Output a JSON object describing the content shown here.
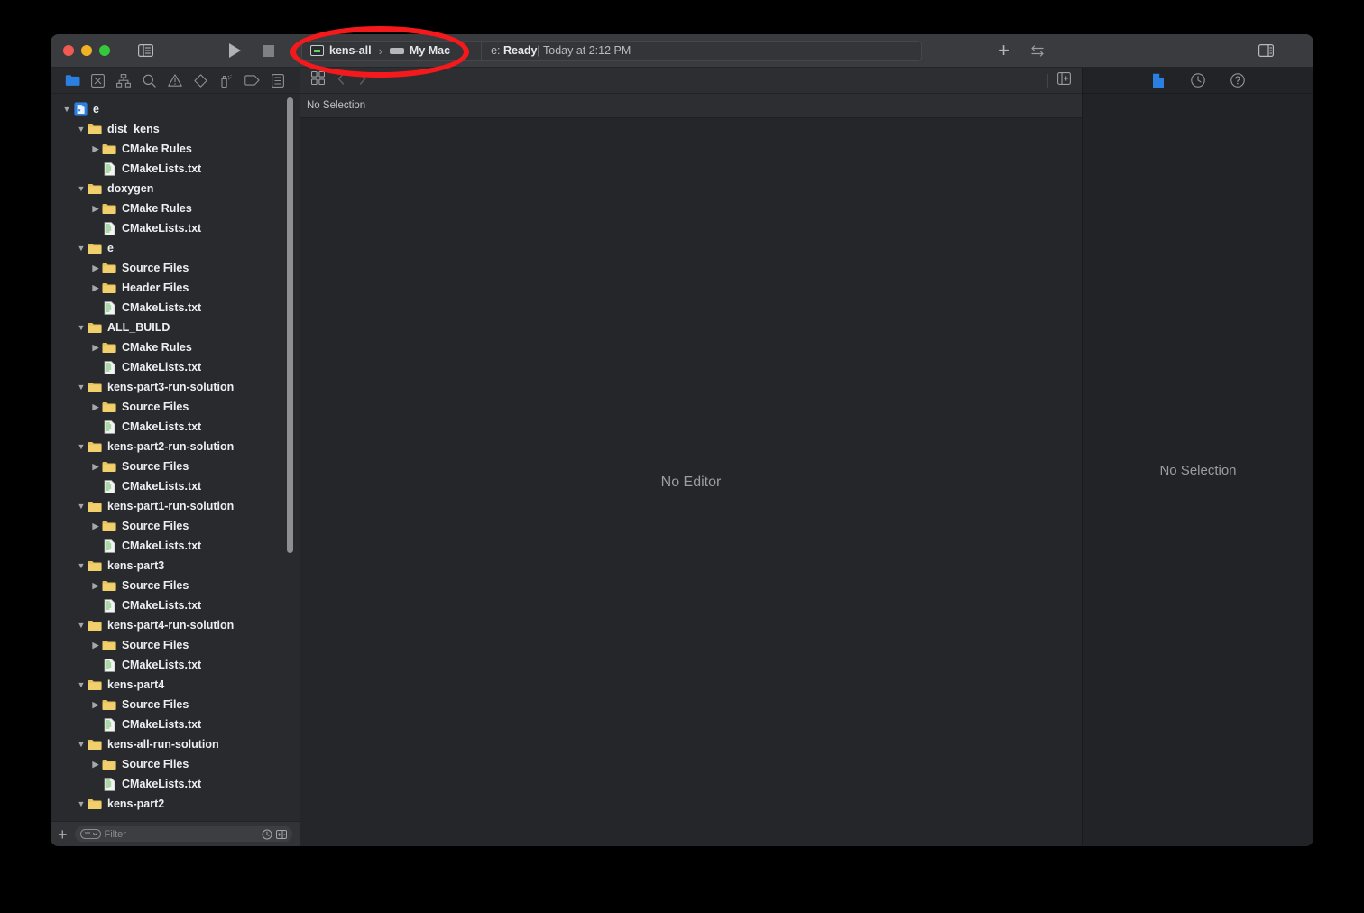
{
  "window": {
    "traffic_lights": [
      "close",
      "minimize",
      "zoom"
    ],
    "sidebar_toggle_icon": "sidebar-left-icon",
    "layout_toggle_icon": "inspector-toggle-icon"
  },
  "toolbar": {
    "run_icon": "play-icon",
    "stop_icon": "stop-icon",
    "scheme_name": "kens-all",
    "scheme_separator": "›",
    "destination_name": "My Mac",
    "status_text_visible": "e: Ready | Today at 2:12 PM",
    "status_prefix": "e: ",
    "status_state": "Ready",
    "status_divider": "|",
    "status_time": "Today at 2:12 PM",
    "add_icon": "plus-icon",
    "toggle_icon": "swap-arrows-icon"
  },
  "navigator": {
    "tabs": [
      {
        "name": "project-navigator",
        "icon": "folder-icon",
        "active": true
      },
      {
        "name": "source-control-navigator",
        "icon": "source-control-icon",
        "active": false
      },
      {
        "name": "symbol-navigator",
        "icon": "hierarchy-icon",
        "active": false
      },
      {
        "name": "find-navigator",
        "icon": "search-icon",
        "active": false
      },
      {
        "name": "issue-navigator",
        "icon": "warning-triangle-icon",
        "active": false
      },
      {
        "name": "test-navigator",
        "icon": "diamond-icon",
        "active": false
      },
      {
        "name": "debug-navigator",
        "icon": "debug-spray-icon",
        "active": false
      },
      {
        "name": "breakpoint-navigator",
        "icon": "tag-icon",
        "active": false
      },
      {
        "name": "report-navigator",
        "icon": "report-icon",
        "active": false
      }
    ],
    "tree": [
      {
        "label": "e",
        "depth": 0,
        "icon": "xcode-project-icon",
        "disclosure": "open"
      },
      {
        "label": "dist_kens",
        "depth": 1,
        "icon": "folder-icon",
        "disclosure": "open"
      },
      {
        "label": "CMake Rules",
        "depth": 2,
        "icon": "folder-icon",
        "disclosure": "closed"
      },
      {
        "label": "CMakeLists.txt",
        "depth": 2,
        "icon": "text-file-icon",
        "disclosure": "none"
      },
      {
        "label": "doxygen",
        "depth": 1,
        "icon": "folder-icon",
        "disclosure": "open"
      },
      {
        "label": "CMake Rules",
        "depth": 2,
        "icon": "folder-icon",
        "disclosure": "closed"
      },
      {
        "label": "CMakeLists.txt",
        "depth": 2,
        "icon": "text-file-icon",
        "disclosure": "none"
      },
      {
        "label": "e",
        "depth": 1,
        "icon": "folder-icon",
        "disclosure": "open"
      },
      {
        "label": "Source Files",
        "depth": 2,
        "icon": "folder-icon",
        "disclosure": "closed"
      },
      {
        "label": "Header Files",
        "depth": 2,
        "icon": "folder-icon",
        "disclosure": "closed"
      },
      {
        "label": "CMakeLists.txt",
        "depth": 2,
        "icon": "text-file-icon",
        "disclosure": "none"
      },
      {
        "label": "ALL_BUILD",
        "depth": 1,
        "icon": "folder-icon",
        "disclosure": "open"
      },
      {
        "label": "CMake Rules",
        "depth": 2,
        "icon": "folder-icon",
        "disclosure": "closed"
      },
      {
        "label": "CMakeLists.txt",
        "depth": 2,
        "icon": "text-file-icon",
        "disclosure": "none"
      },
      {
        "label": "kens-part3-run-solution",
        "depth": 1,
        "icon": "folder-icon",
        "disclosure": "open"
      },
      {
        "label": "Source Files",
        "depth": 2,
        "icon": "folder-icon",
        "disclosure": "closed"
      },
      {
        "label": "CMakeLists.txt",
        "depth": 2,
        "icon": "text-file-icon",
        "disclosure": "none"
      },
      {
        "label": "kens-part2-run-solution",
        "depth": 1,
        "icon": "folder-icon",
        "disclosure": "open"
      },
      {
        "label": "Source Files",
        "depth": 2,
        "icon": "folder-icon",
        "disclosure": "closed"
      },
      {
        "label": "CMakeLists.txt",
        "depth": 2,
        "icon": "text-file-icon",
        "disclosure": "none"
      },
      {
        "label": "kens-part1-run-solution",
        "depth": 1,
        "icon": "folder-icon",
        "disclosure": "open"
      },
      {
        "label": "Source Files",
        "depth": 2,
        "icon": "folder-icon",
        "disclosure": "closed"
      },
      {
        "label": "CMakeLists.txt",
        "depth": 2,
        "icon": "text-file-icon",
        "disclosure": "none"
      },
      {
        "label": "kens-part3",
        "depth": 1,
        "icon": "folder-icon",
        "disclosure": "open"
      },
      {
        "label": "Source Files",
        "depth": 2,
        "icon": "folder-icon",
        "disclosure": "closed"
      },
      {
        "label": "CMakeLists.txt",
        "depth": 2,
        "icon": "text-file-icon",
        "disclosure": "none"
      },
      {
        "label": "kens-part4-run-solution",
        "depth": 1,
        "icon": "folder-icon",
        "disclosure": "open"
      },
      {
        "label": "Source Files",
        "depth": 2,
        "icon": "folder-icon",
        "disclosure": "closed"
      },
      {
        "label": "CMakeLists.txt",
        "depth": 2,
        "icon": "text-file-icon",
        "disclosure": "none"
      },
      {
        "label": "kens-part4",
        "depth": 1,
        "icon": "folder-icon",
        "disclosure": "open"
      },
      {
        "label": "Source Files",
        "depth": 2,
        "icon": "folder-icon",
        "disclosure": "closed"
      },
      {
        "label": "CMakeLists.txt",
        "depth": 2,
        "icon": "text-file-icon",
        "disclosure": "none"
      },
      {
        "label": "kens-all-run-solution",
        "depth": 1,
        "icon": "folder-icon",
        "disclosure": "open"
      },
      {
        "label": "Source Files",
        "depth": 2,
        "icon": "folder-icon",
        "disclosure": "closed"
      },
      {
        "label": "CMakeLists.txt",
        "depth": 2,
        "icon": "text-file-icon",
        "disclosure": "none"
      },
      {
        "label": "kens-part2",
        "depth": 1,
        "icon": "folder-icon",
        "disclosure": "open"
      }
    ],
    "filter_bar": {
      "add_label": "+",
      "placeholder": "Filter",
      "recent_icon": "clock-icon",
      "sourcecontrol_icon": "add-filter-icon"
    }
  },
  "editor": {
    "jumpbar": {
      "grid_icon": "grid-view-icon",
      "back_icon": "chevron-left-icon",
      "forward_icon": "chevron-right-icon",
      "add_editor_icon": "add-editor-icon"
    },
    "breadcrumb_text": "No Selection",
    "placeholder_text": "No Editor"
  },
  "inspector": {
    "tabs": [
      {
        "name": "file-inspector",
        "icon": "file-icon",
        "active": true
      },
      {
        "name": "history-inspector",
        "icon": "clock-icon",
        "active": false
      },
      {
        "name": "quick-help-inspector",
        "icon": "question-icon",
        "active": false
      }
    ],
    "placeholder_text": "No Selection"
  },
  "annotation": {
    "shape": "ellipse",
    "color": "#f5191b",
    "targets": "scheme-destination-selector"
  },
  "colors": {
    "accent_blue": "#2b7fe0",
    "annotation_red": "#f5191b",
    "titlebar_bg": "#3a3b3e",
    "navigator_bg": "#292a2d",
    "editor_bg": "#252629",
    "inspector_bg": "#222326",
    "folder_yellow": "#e8c25c",
    "file_green": "#6ec464"
  }
}
